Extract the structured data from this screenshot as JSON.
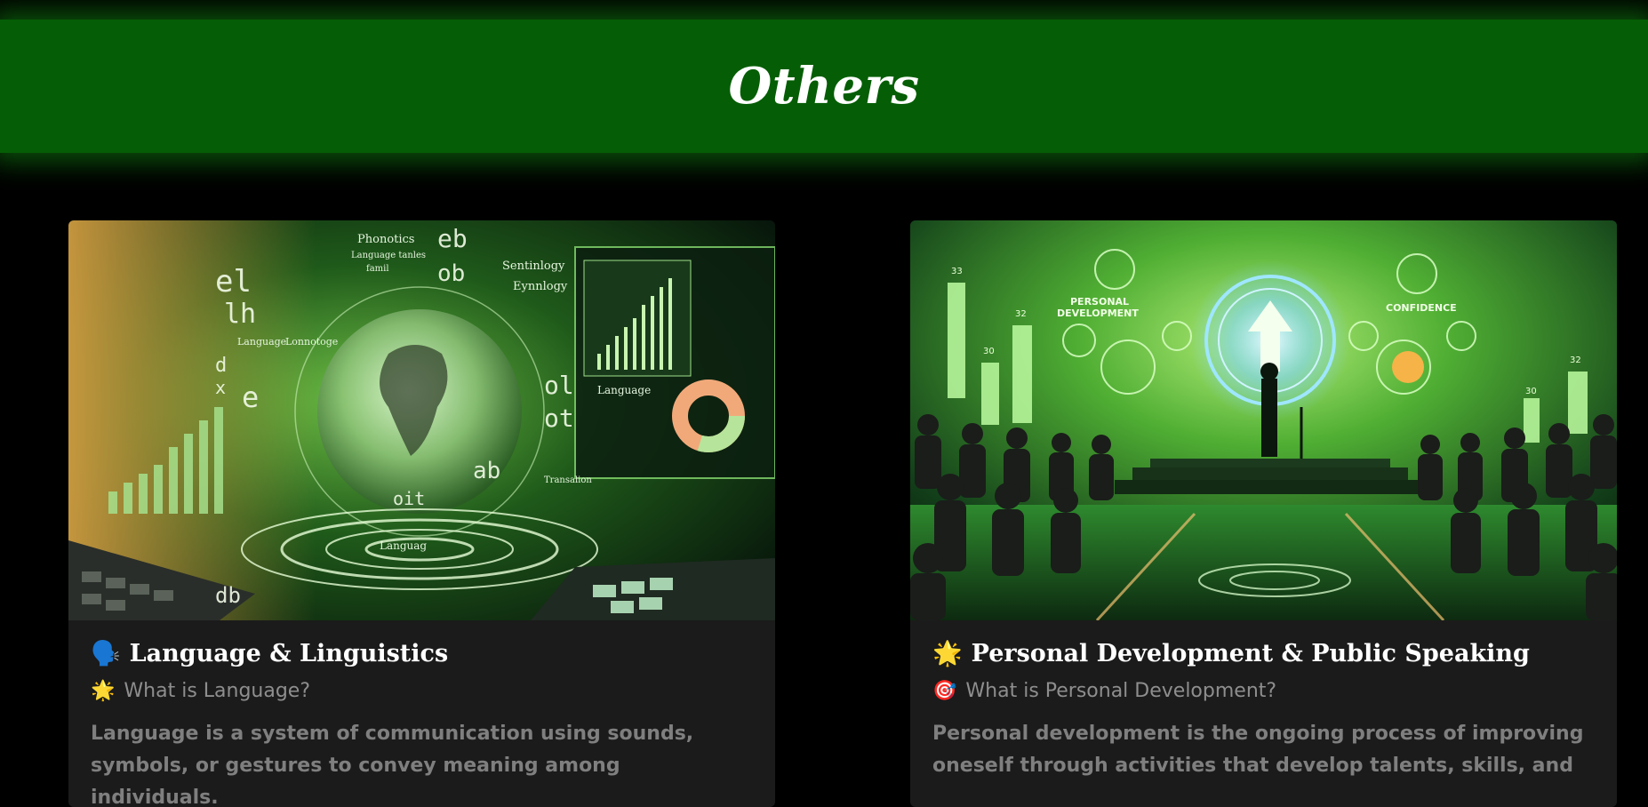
{
  "page": {
    "banner_title": "Others"
  },
  "cards": [
    {
      "title_icon": "speaking-head-icon",
      "title_emoji": "🗣️",
      "title": "Language & Linguistics",
      "subtitle_icon": "sun-icon",
      "subtitle_emoji": "🌟",
      "subtitle": "What is Language?",
      "description": "Language is a system of communication using sounds, symbols, or gestures to convey meaning among individuals.",
      "image_text": {
        "labels": [
          "Phonotics",
          "Language tanles",
          "famil",
          "Sentinlogy",
          "Eynnlogy",
          "Language",
          "Language",
          "Lonnotoge",
          "Transalion",
          "Languag"
        ],
        "glyphs": [
          "eb",
          "ob",
          "el",
          "ol",
          "ot",
          "ab",
          "oit",
          "db",
          "lh",
          "e",
          "d",
          "x"
        ]
      }
    },
    {
      "title_icon": "sun-icon",
      "title_emoji": "🌟",
      "title": "Personal Development & Public Speaking",
      "subtitle_icon": "target-icon",
      "subtitle_emoji": "🎯",
      "subtitle": "What is Personal Development?",
      "description": "Personal development is the ongoing process of improving oneself through activities that develop talents, skills, and",
      "image_text": {
        "labels": [
          "PERSONAL",
          "DEVELOPMENT",
          "CONFIDENCE"
        ],
        "numbers": [
          "33",
          "32",
          "30",
          "32",
          "30"
        ]
      }
    }
  ],
  "colors": {
    "background": "#000000",
    "banner": "#055e05",
    "card": "#1b1b1b",
    "accent_green": "#7dff5a"
  }
}
